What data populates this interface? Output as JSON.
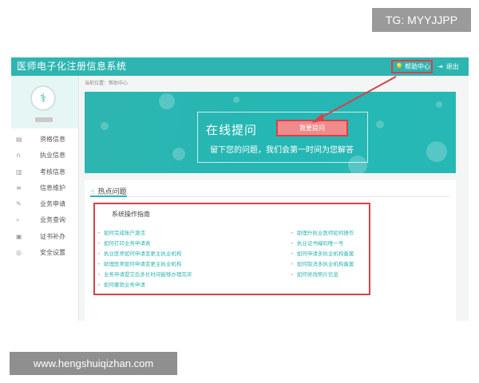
{
  "watermark_top": "TG: MYYJJPP",
  "watermark_bottom": "www.hengshuiqizhan.com",
  "topbar": {
    "system_title": "医师电子化注册信息系统",
    "help_label": "帮助中心",
    "logout_label": "退出"
  },
  "sidebar": {
    "items": [
      {
        "label": "资格信息",
        "icon": "id-card-icon"
      },
      {
        "label": "执业信息",
        "icon": "headset-icon"
      },
      {
        "label": "考核信息",
        "icon": "clipboard-icon"
      },
      {
        "label": "信息维护",
        "icon": "list-icon"
      },
      {
        "label": "业务申请",
        "icon": "edit-icon"
      },
      {
        "label": "业务查询",
        "icon": "search-icon"
      },
      {
        "label": "证书补办",
        "icon": "certificate-icon"
      },
      {
        "label": "安全设置",
        "icon": "lock-icon"
      }
    ]
  },
  "content": {
    "breadcrumb": "当前位置：帮助中心"
  },
  "banner": {
    "title": "在线提问",
    "ask_button": "我要提问",
    "slogan": "留下您的问题，我们会第一时间为您解答"
  },
  "hot": {
    "heading": "热点问题",
    "section_title": "系统操作指南",
    "left": [
      "如何完成账户激活",
      "如何打印业务申请表",
      "执业医师如何申请变更主执业机构",
      "助理医师如何申请变更主执业机构",
      "业务申请提交后多长时间能够办理完毕",
      "如何撤销业务申请"
    ],
    "right": [
      "助理升执业医师如何操作",
      "执业证书编码唯一号",
      "如何申请多执业机构备案",
      "如何取消多执业机构备案",
      "如何修改照片信息"
    ]
  },
  "colors": {
    "brand_teal": "#2eb5b1",
    "annotation_red": "#d9404a",
    "button_pink": "#f08b8b"
  }
}
